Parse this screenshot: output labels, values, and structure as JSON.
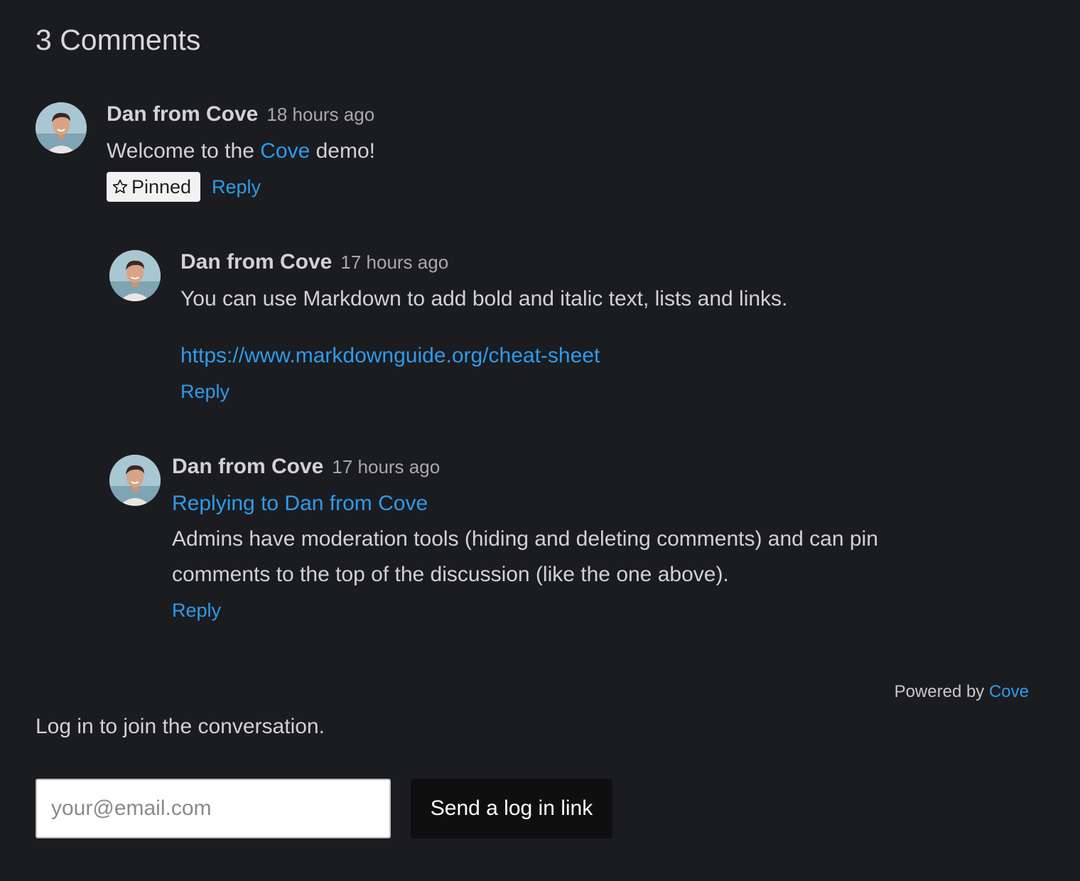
{
  "heading": "3 Comments",
  "comments": [
    {
      "author": "Dan from Cove",
      "time": "18 hours ago",
      "body_before": "Welcome to the ",
      "body_link": "Cove",
      "body_after": " demo!",
      "pinned_label": "Pinned",
      "reply_label": "Reply"
    },
    {
      "author": "Dan from Cove",
      "time": "17 hours ago",
      "body": "You can use Markdown to add bold and italic text, lists and links.",
      "link": "https://www.markdownguide.org/cheat-sheet",
      "reply_label": "Reply"
    },
    {
      "author": "Dan from Cove",
      "time": "17 hours ago",
      "replying_to": "Replying to Dan from Cove",
      "body_line1": "Admins have moderation tools (hiding and deleting comments) and can pin",
      "body_line2": "comments to the top of the discussion (like the one above).",
      "reply_label": "Reply"
    }
  ],
  "footer": {
    "powered_prefix": "Powered by ",
    "powered_link": "Cove",
    "login_prompt": "Log in to join the conversation.",
    "email_placeholder": "your@email.com",
    "send_label": "Send a log in link"
  },
  "icons": {
    "pinned": "star-outline-icon",
    "avatar": "user-avatar"
  },
  "colors": {
    "background": "#1b1c20",
    "link": "#2e9bea",
    "text": "#d2d2d2",
    "button_bg": "#0f0f10"
  }
}
